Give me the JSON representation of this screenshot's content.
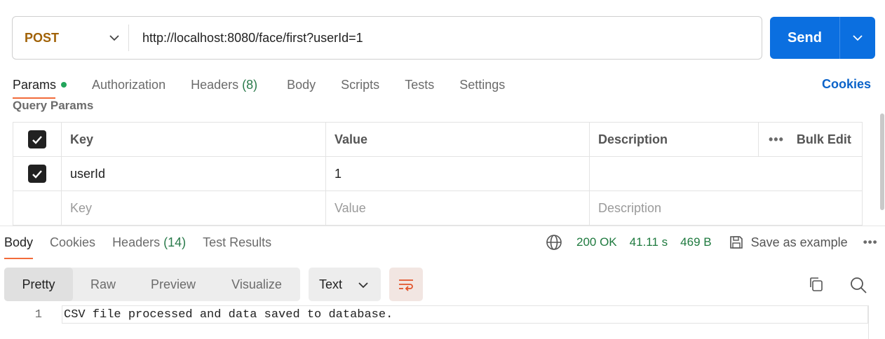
{
  "request": {
    "method": "POST",
    "url": "http://localhost:8080/face/first?userId=1",
    "send_label": "Send"
  },
  "req_tabs": [
    {
      "label": "Params"
    },
    {
      "label": "Authorization"
    },
    {
      "label": "Headers",
      "count": "(8)"
    },
    {
      "label": "Body"
    },
    {
      "label": "Scripts"
    },
    {
      "label": "Tests"
    },
    {
      "label": "Settings"
    }
  ],
  "cookies_label": "Cookies",
  "query_params_title": "Query Params",
  "params_table": {
    "headers": {
      "key": "Key",
      "value": "Value",
      "description": "Description",
      "bulk_edit": "Bulk Edit",
      "more": "•••"
    },
    "rows": [
      {
        "key": "userId",
        "value": "1",
        "description": ""
      }
    ],
    "placeholders": {
      "key": "Key",
      "value": "Value",
      "description": "Description"
    }
  },
  "response": {
    "tabs": [
      {
        "label": "Body"
      },
      {
        "label": "Cookies"
      },
      {
        "label": "Headers",
        "count": "(14)"
      },
      {
        "label": "Test Results"
      }
    ],
    "status": "200 OK",
    "time": "41.11 s",
    "size": "469 B",
    "save_example": "Save as example",
    "more": "•••",
    "view_modes": [
      "Pretty",
      "Raw",
      "Preview",
      "Visualize"
    ],
    "format": "Text",
    "body_lines": [
      {
        "number": "1",
        "text": "CSV file processed and data saved to database."
      }
    ]
  },
  "colors": {
    "method": "#a16207",
    "send_bg": "#0b6fe0",
    "active_tab_underline": "#f26b3a",
    "status_green": "#1f7a3f",
    "link_blue": "#0b63c9"
  }
}
